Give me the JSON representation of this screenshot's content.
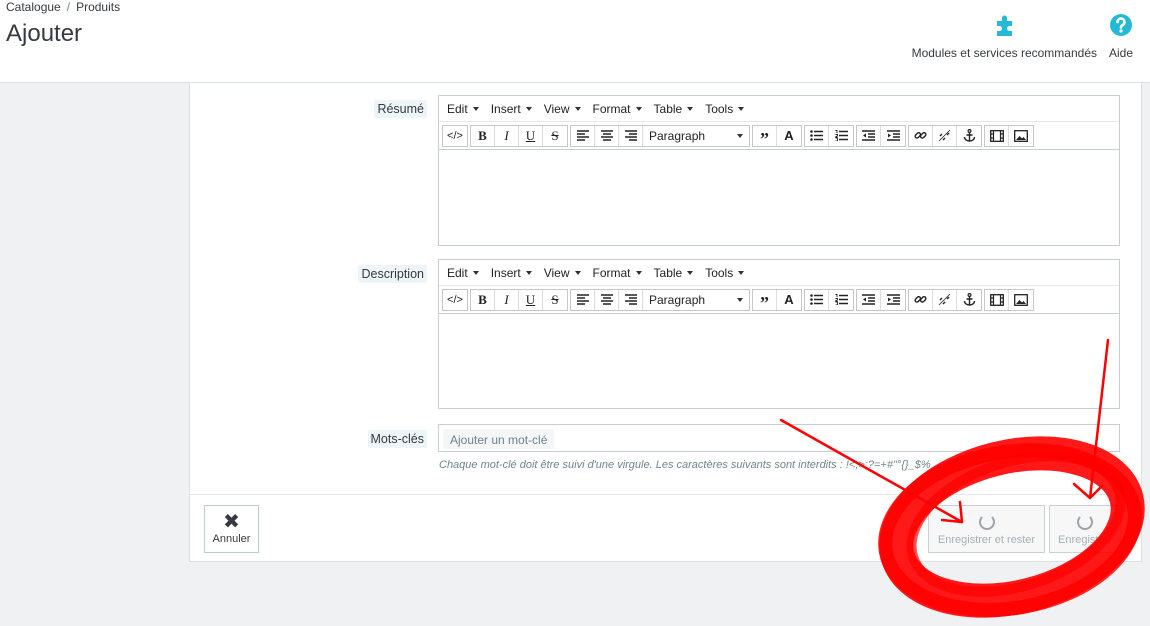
{
  "header": {
    "breadcrumb": [
      "Catalogue",
      "Produits"
    ],
    "breadcrumb_sep": "/",
    "title": "Ajouter",
    "modules_label": "Modules et services recommandés",
    "help_label": "Aide"
  },
  "editor_menu": [
    "Edit",
    "Insert",
    "View",
    "Format",
    "Table",
    "Tools"
  ],
  "editor_format_select": "Paragraph",
  "fields": {
    "summary_label": "Résumé",
    "description_label": "Description",
    "keywords_label": "Mots-clés",
    "keywords_placeholder": "Ajouter un mot-clé",
    "keywords_help": "Chaque mot-clé doit être suivi d'une virgule. Les caractères suivants sont interdits : !<;>;?=+#\"°{}_$%"
  },
  "footer": {
    "cancel_label": "Annuler",
    "save_stay_label": "Enregistrer et rester",
    "save_label": "Enregistrer"
  },
  "colors": {
    "brand_teal": "#25b9d7",
    "annotation_red": "#ff0000"
  }
}
